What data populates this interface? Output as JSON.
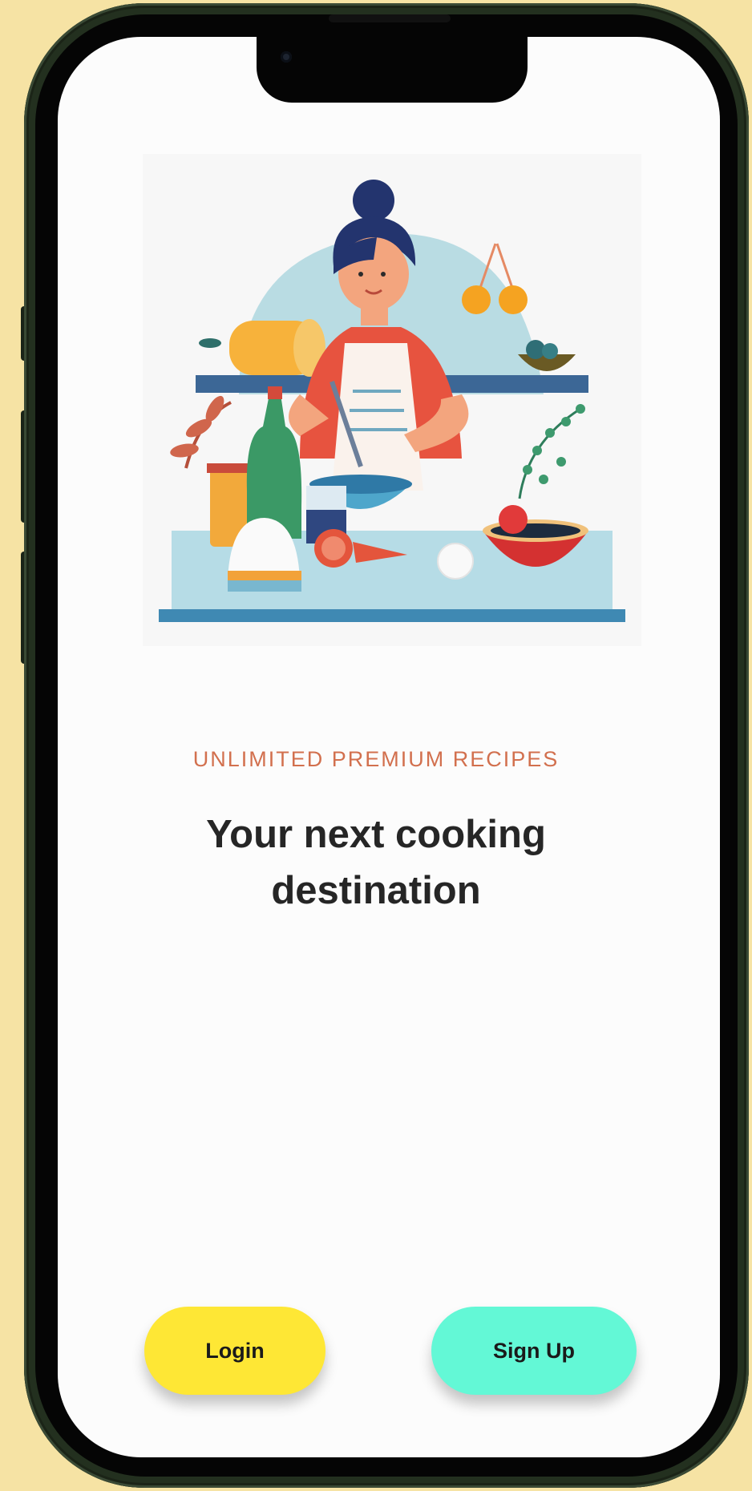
{
  "onboarding": {
    "eyebrow": "UNLIMITED PREMIUM RECIPES",
    "title": "Your next cooking destination",
    "illustration_icon": "chef-cooking-illustration"
  },
  "actions": {
    "login_label": "Login",
    "signup_label": "Sign Up"
  },
  "colors": {
    "background": "#F6E3A4",
    "eyebrow": "#D2704E",
    "title": "#262626",
    "login_button": "#FEE735",
    "signup_button": "#63F8D6"
  }
}
